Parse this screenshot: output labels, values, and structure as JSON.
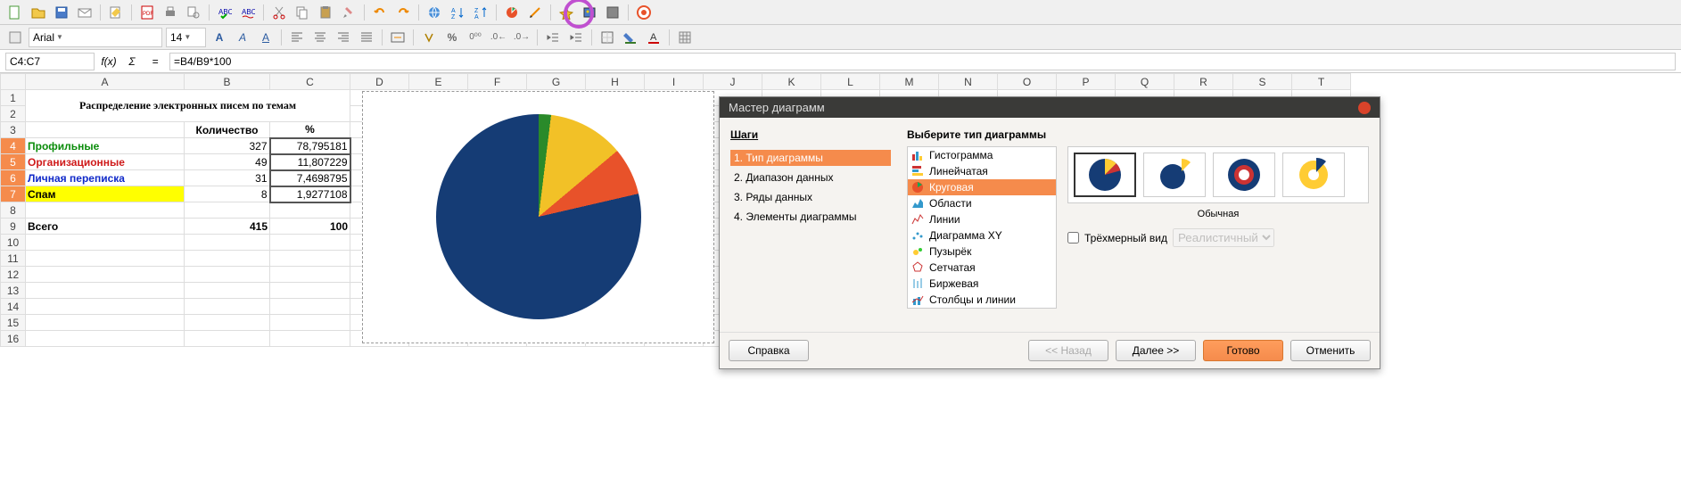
{
  "toolbar": {
    "font_name": "Arial",
    "font_size": "14"
  },
  "formula_bar": {
    "cell_ref": "C4:C7",
    "fx": "f(x)",
    "sigma": "Σ",
    "eq": "=",
    "formula": "=B4/B9*100"
  },
  "columns": [
    "A",
    "B",
    "C",
    "D",
    "E",
    "F",
    "G",
    "H",
    "I",
    "J",
    "K",
    "L",
    "M",
    "N",
    "O",
    "P",
    "Q",
    "R",
    "S",
    "T"
  ],
  "rows": [
    "1",
    "2",
    "3",
    "4",
    "5",
    "6",
    "7",
    "8",
    "9",
    "10",
    "11",
    "12",
    "13",
    "14",
    "15",
    "16"
  ],
  "sheet": {
    "title": "Распределение электронных писем по темам",
    "hdr_qty": "Количество",
    "hdr_pct": "%",
    "r4": {
      "a": "Профильные",
      "b": "327",
      "c": "78,795181",
      "color": "#0a8c0a"
    },
    "r5": {
      "a": "Организационные",
      "b": "49",
      "c": "11,807229",
      "color": "#cf1a1a"
    },
    "r6": {
      "a": "Личная переписка",
      "b": "31",
      "c": "7,4698795",
      "color": "#1029c9"
    },
    "r7": {
      "a": "Спам",
      "b": "8",
      "c": "1,9277108",
      "bg": "#ffff00"
    },
    "r9": {
      "a": "Всего",
      "b": "415",
      "c": "100"
    }
  },
  "wizard": {
    "title": "Мастер диаграмм",
    "steps_label": "Шаги",
    "steps": [
      "1. Тип диаграммы",
      "2. Диапазон данных",
      "3. Ряды данных",
      "4. Элементы диаграммы"
    ],
    "choose_type": "Выберите тип диаграммы",
    "types": [
      "Гистограмма",
      "Линейчатая",
      "Круговая",
      "Области",
      "Линии",
      "Диаграмма XY",
      "Пузырёк",
      "Сетчатая",
      "Биржевая",
      "Столбцы и линии"
    ],
    "subtype_label": "Обычная",
    "opt3d": "Трёхмерный вид",
    "opt3d_style": "Реалистичный",
    "btn_help": "Справка",
    "btn_back": "<< Назад",
    "btn_next": "Далее >>",
    "btn_finish": "Готово",
    "btn_cancel": "Отменить"
  },
  "chart_data": {
    "type": "pie",
    "title": "Распределение электронных писем по темам",
    "categories": [
      "Профильные",
      "Организационные",
      "Личная переписка",
      "Спам"
    ],
    "values": [
      327,
      49,
      31,
      8
    ],
    "percentages": [
      78.795181,
      11.807229,
      7.4698795,
      1.9277108
    ],
    "colors": [
      "#153c75",
      "#e8522a",
      "#f2c127",
      "#2a8a2a"
    ]
  }
}
